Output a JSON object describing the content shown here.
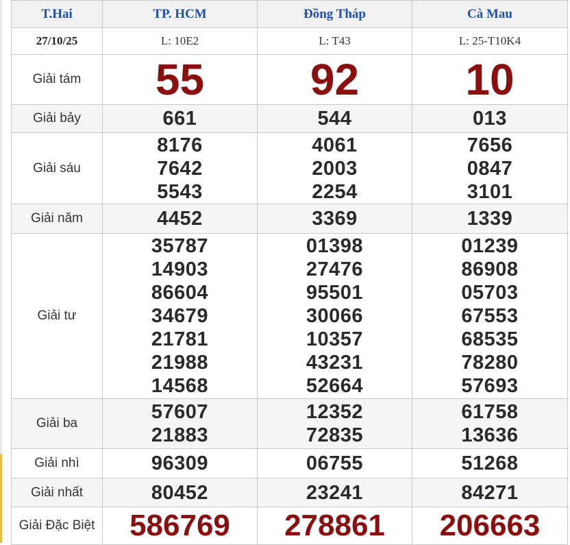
{
  "header": {
    "weekday": "T.Hai",
    "provinces": [
      "TP. HCM",
      "Đồng Tháp",
      "Cà Mau"
    ]
  },
  "subheader": {
    "date": "27/10/25",
    "tickets": [
      "L: 10E2",
      "L: T43",
      "L: 25-T10K4"
    ]
  },
  "prizes": {
    "g8": {
      "label": "Giải tám",
      "values": [
        [
          "55"
        ],
        [
          "92"
        ],
        [
          "10"
        ]
      ]
    },
    "g7": {
      "label": "Giải bảy",
      "values": [
        [
          "661"
        ],
        [
          "544"
        ],
        [
          "013"
        ]
      ]
    },
    "g6": {
      "label": "Giải sáu",
      "values": [
        [
          "8176",
          "7642",
          "5543"
        ],
        [
          "4061",
          "2003",
          "2254"
        ],
        [
          "7656",
          "0847",
          "3101"
        ]
      ]
    },
    "g5": {
      "label": "Giải năm",
      "values": [
        [
          "4452"
        ],
        [
          "3369"
        ],
        [
          "1339"
        ]
      ]
    },
    "g4": {
      "label": "Giải tư",
      "values": [
        [
          "35787",
          "14903",
          "86604",
          "34679",
          "21781",
          "21988",
          "14568"
        ],
        [
          "01398",
          "27476",
          "95501",
          "30066",
          "10357",
          "43231",
          "52664"
        ],
        [
          "01239",
          "86908",
          "05703",
          "67553",
          "68535",
          "78280",
          "57693"
        ]
      ]
    },
    "g3": {
      "label": "Giải ba",
      "values": [
        [
          "57607",
          "21883"
        ],
        [
          "12352",
          "72835"
        ],
        [
          "61758",
          "13636"
        ]
      ]
    },
    "g2": {
      "label": "Giải nhì",
      "values": [
        [
          "96309"
        ],
        [
          "06755"
        ],
        [
          "51268"
        ]
      ]
    },
    "g1": {
      "label": "Giải nhất",
      "values": [
        [
          "80452"
        ],
        [
          "23241"
        ],
        [
          "84271"
        ]
      ]
    },
    "gdb": {
      "label": "Giải Đặc Biệt",
      "values": [
        [
          "586769"
        ],
        [
          "278861"
        ],
        [
          "206663"
        ]
      ]
    }
  },
  "colors": {
    "header_text": "#1f4fb0",
    "highlight_number": "#8b0f0f",
    "number": "#2a2a2a",
    "row_shade": "#f5f5f5"
  }
}
